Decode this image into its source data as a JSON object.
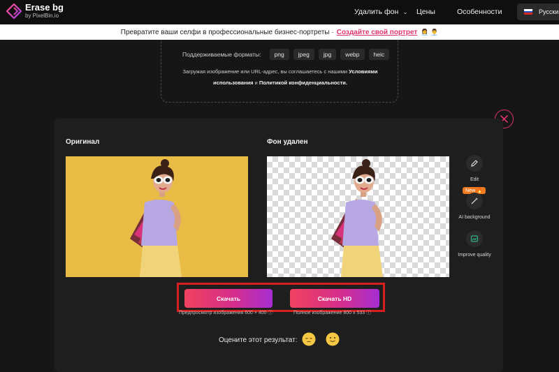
{
  "header": {
    "brand_title": "Erase bg",
    "brand_sub": "by PixelBin.io",
    "nav": {
      "remove_bg": "Удалить фон",
      "prices": "Цены",
      "features": "Особенности"
    },
    "language": "Русский"
  },
  "banner": {
    "text": "Превратите ваши селфи в профессиональные бизнес-портреты ·",
    "link": "Создайте свой портрет",
    "emoji": "👩‍💼 👨‍💼"
  },
  "upload": {
    "formats_label": "Поддерживаемые форматы:",
    "formats": [
      "png",
      "jpeg",
      "jpg",
      "webp",
      "heic"
    ],
    "consent_prefix": "Загружая изображение или URL-адрес, вы соглашаетесь с нашими",
    "terms": "Условиями использования",
    "and": "и",
    "privacy": "Политикой конфиденциальности."
  },
  "result": {
    "original_title": "Оригинал",
    "removed_title": "Фон удален",
    "tools": {
      "edit": "Edit",
      "new_badge": "New 🔥",
      "ai_background": "AI background",
      "improve_quality": "Improve quality"
    },
    "download_label": "Скачать",
    "download_hd_label": "Скачать HD",
    "preview_note": "Предпросмотр изображения 600 × 400 ⓘ",
    "full_note": "Полное изображение 800 x 533 ⓘ",
    "rate_label": "Оцените этот результат:"
  },
  "colors": {
    "accent": "#e0336b",
    "original_bg": "#e9bc45",
    "highlight": "#d91e1e"
  }
}
